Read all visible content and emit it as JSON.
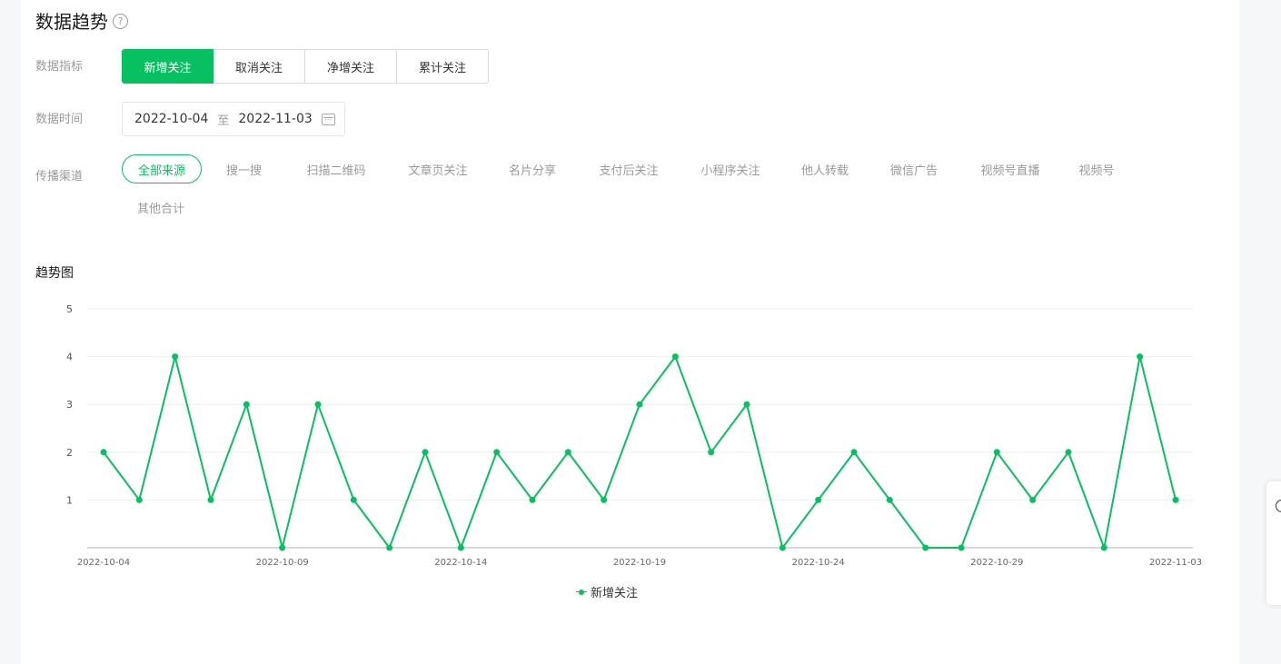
{
  "header": {
    "title": "数据趋势",
    "help_icon": "question-circle-icon"
  },
  "metric": {
    "label": "数据指标",
    "options": [
      "新增关注",
      "取消关注",
      "净增关注",
      "累计关注"
    ],
    "active": "新增关注"
  },
  "time": {
    "label": "数据时间",
    "start": "2022-10-04",
    "separator": "至",
    "end": "2022-11-03",
    "icon": "calendar-icon"
  },
  "channel": {
    "label": "传播渠道",
    "options": [
      "全部来源",
      "搜一搜",
      "扫描二维码",
      "文章页关注",
      "名片分享",
      "支付后关注",
      "小程序关注",
      "他人转载",
      "微信广告",
      "视频号直播",
      "视频号",
      "其他合计"
    ],
    "active": "全部来源"
  },
  "chart_section": {
    "title": "趋势图"
  },
  "colors": {
    "accent": "#07c160",
    "grid": "#eeeeee",
    "axis": "#cccccc",
    "muted": "#9a9a9a"
  },
  "chart_data": {
    "type": "line",
    "x": [
      "2022-10-04",
      "2022-10-05",
      "2022-10-06",
      "2022-10-07",
      "2022-10-08",
      "2022-10-09",
      "2022-10-10",
      "2022-10-11",
      "2022-10-12",
      "2022-10-13",
      "2022-10-14",
      "2022-10-15",
      "2022-10-16",
      "2022-10-17",
      "2022-10-18",
      "2022-10-19",
      "2022-10-20",
      "2022-10-21",
      "2022-10-22",
      "2022-10-23",
      "2022-10-24",
      "2022-10-25",
      "2022-10-26",
      "2022-10-27",
      "2022-10-28",
      "2022-10-29",
      "2022-10-30",
      "2022-10-31",
      "2022-11-01",
      "2022-11-02",
      "2022-11-03"
    ],
    "x_tick_labels": [
      "2022-10-04",
      "2022-10-09",
      "2022-10-14",
      "2022-10-19",
      "2022-10-24",
      "2022-10-29",
      "2022-11-03"
    ],
    "series": [
      {
        "name": "新增关注",
        "values": [
          2,
          1,
          4,
          1,
          3,
          0,
          3,
          1,
          0,
          2,
          0,
          2,
          1,
          2,
          1,
          3,
          4,
          2,
          3,
          0,
          1,
          2,
          1,
          0,
          0,
          2,
          1,
          2,
          0,
          4,
          1
        ]
      }
    ],
    "y_ticks": [
      1,
      2,
      3,
      4,
      5
    ],
    "ylim": [
      0,
      5
    ],
    "grid": true,
    "legend": "bottom-center"
  }
}
